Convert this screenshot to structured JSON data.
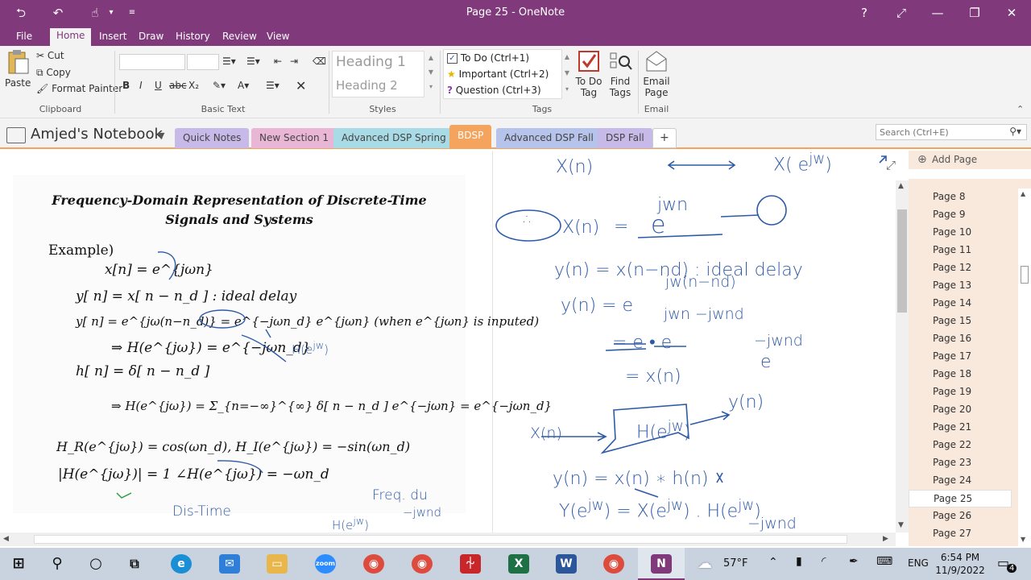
{
  "window": {
    "title": "Page 25 - OneNote"
  },
  "menu": {
    "tabs": [
      "File",
      "Home",
      "Insert",
      "Draw",
      "History",
      "Review",
      "View"
    ]
  },
  "ribbon": {
    "clipboard": {
      "paste": "Paste",
      "cut": "Cut",
      "copy": "Copy",
      "format_painter": "Format Painter",
      "label": "Clipboard"
    },
    "basic_text": {
      "label": "Basic Text",
      "bold": "B",
      "italic": "I",
      "underline": "U",
      "strike": "abc",
      "subscript": "X₂"
    },
    "styles": {
      "heading1": "Heading 1",
      "heading2": "Heading 2",
      "label": "Styles"
    },
    "tags": {
      "todo": "To Do (Ctrl+1)",
      "important": "Important (Ctrl+2)",
      "question": "Question (Ctrl+3)",
      "todo_tag_line1": "To Do",
      "todo_tag_line2": "Tag",
      "find_tags_line1": "Find",
      "find_tags_line2": "Tags",
      "label": "Tags"
    },
    "email": {
      "line1": "Email",
      "line2": "Page",
      "label": "Email"
    }
  },
  "notebook": {
    "name": "Amjed's Notebook",
    "sections": [
      {
        "label": "Quick Notes",
        "color": "#c7b9e8"
      },
      {
        "label": "New Section 1",
        "color": "#e9b6d6"
      },
      {
        "label": "Advanced DSP Spring",
        "color": "#a9dbe6"
      },
      {
        "label": "BDSP",
        "color": "#f4a45d"
      },
      {
        "label": "Advanced DSP Fall",
        "color": "#b6c3ea"
      },
      {
        "label": "DSP Fall",
        "color": "#c7b9e8"
      }
    ],
    "add_section": "+",
    "search_placeholder": "Search (Ctrl+E)"
  },
  "slide": {
    "title_line1": "Frequency-Domain Representation of Discrete-Time",
    "title_line2": "Signals and Systems",
    "example": "Example)",
    "eq1": "x[n] = e^{jωn}",
    "eq2": "y[ n] = x[ n − n_d ]  :  ideal delay",
    "eq3": "y[ n] = e^{jω(n−n_d)} = e^{−jωn_d} e^{jωn} (when e^{jωn} is inputed)",
    "eq4": "⇒ H(e^{jω}) = e^{−jωn_d}",
    "eq5": "h[ n] = δ[ n − n_d ]",
    "eq6": "⇒ H(e^{jω}) = Σ_{n=−∞}^{∞} δ[ n − n_d ] e^{−jωn} = e^{−jωn_d}",
    "eq7": "H_R(e^{jω}) = cos(ωn_d),   H_I(e^{jω}) = −sin(ωn_d)",
    "eq8": "|H(e^{jω})| = 1   ∠H(e^{jω}) = −ωn_d"
  },
  "pages": {
    "add_page": "Add Page",
    "items": [
      "Page 8",
      "Page 9",
      "Page 10",
      "Page 11",
      "Page 12",
      "Page 13",
      "Page 14",
      "Page 15",
      "Page 16",
      "Page 17",
      "Page 18",
      "Page 19",
      "Page 20",
      "Page 21",
      "Page 22",
      "Page 23",
      "Page 24",
      "Page 25",
      "Page 26",
      "Page 27"
    ],
    "selected": "Page 25"
  },
  "taskbar": {
    "weather": "57°F",
    "language": "ENG",
    "time": "6:54 PM",
    "date": "11/9/2022",
    "notification_count": "4"
  },
  "colors": {
    "accent": "#80397b",
    "section_active": "#f4a45d",
    "ink": "#2d5aa8"
  }
}
